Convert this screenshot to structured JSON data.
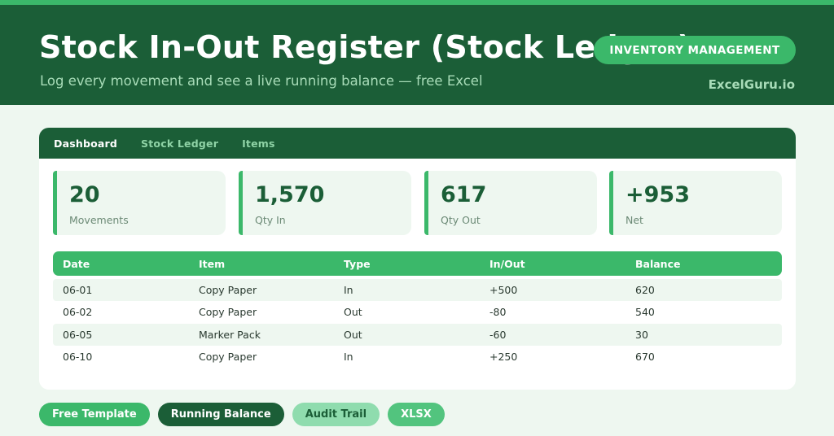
{
  "header": {
    "title": "Stock In-Out Register (Stock Ledger)",
    "subtitle": "Log every movement and see a live running balance — free Excel",
    "badge": "INVENTORY MANAGEMENT",
    "brand": "ExcelGuru.io"
  },
  "tabs": [
    {
      "label": "Dashboard",
      "active": true
    },
    {
      "label": "Stock Ledger",
      "active": false
    },
    {
      "label": "Items",
      "active": false
    }
  ],
  "stats": [
    {
      "value": "20",
      "label": "Movements"
    },
    {
      "value": "1,570",
      "label": "Qty In"
    },
    {
      "value": "617",
      "label": "Qty Out"
    },
    {
      "value": "+953",
      "label": "Net"
    }
  ],
  "table": {
    "columns": [
      "Date",
      "Item",
      "Type",
      "In/Out",
      "Balance"
    ],
    "rows": [
      [
        "06-01",
        "Copy Paper",
        "In",
        "+500",
        "620"
      ],
      [
        "06-02",
        "Copy Paper",
        "Out",
        "-80",
        "540"
      ],
      [
        "06-05",
        "Marker Pack",
        "Out",
        "-60",
        "30"
      ],
      [
        "06-10",
        "Copy Paper",
        "In",
        "+250",
        "670"
      ]
    ]
  },
  "tags": [
    "Free Template",
    "Running Balance",
    "Audit Trail",
    "XLSX"
  ],
  "colors": {
    "dark_green": "#1b5e37",
    "accent_green": "#3bb86a",
    "light_bg": "#eef7f0",
    "muted_text": "#a8dcb8"
  }
}
